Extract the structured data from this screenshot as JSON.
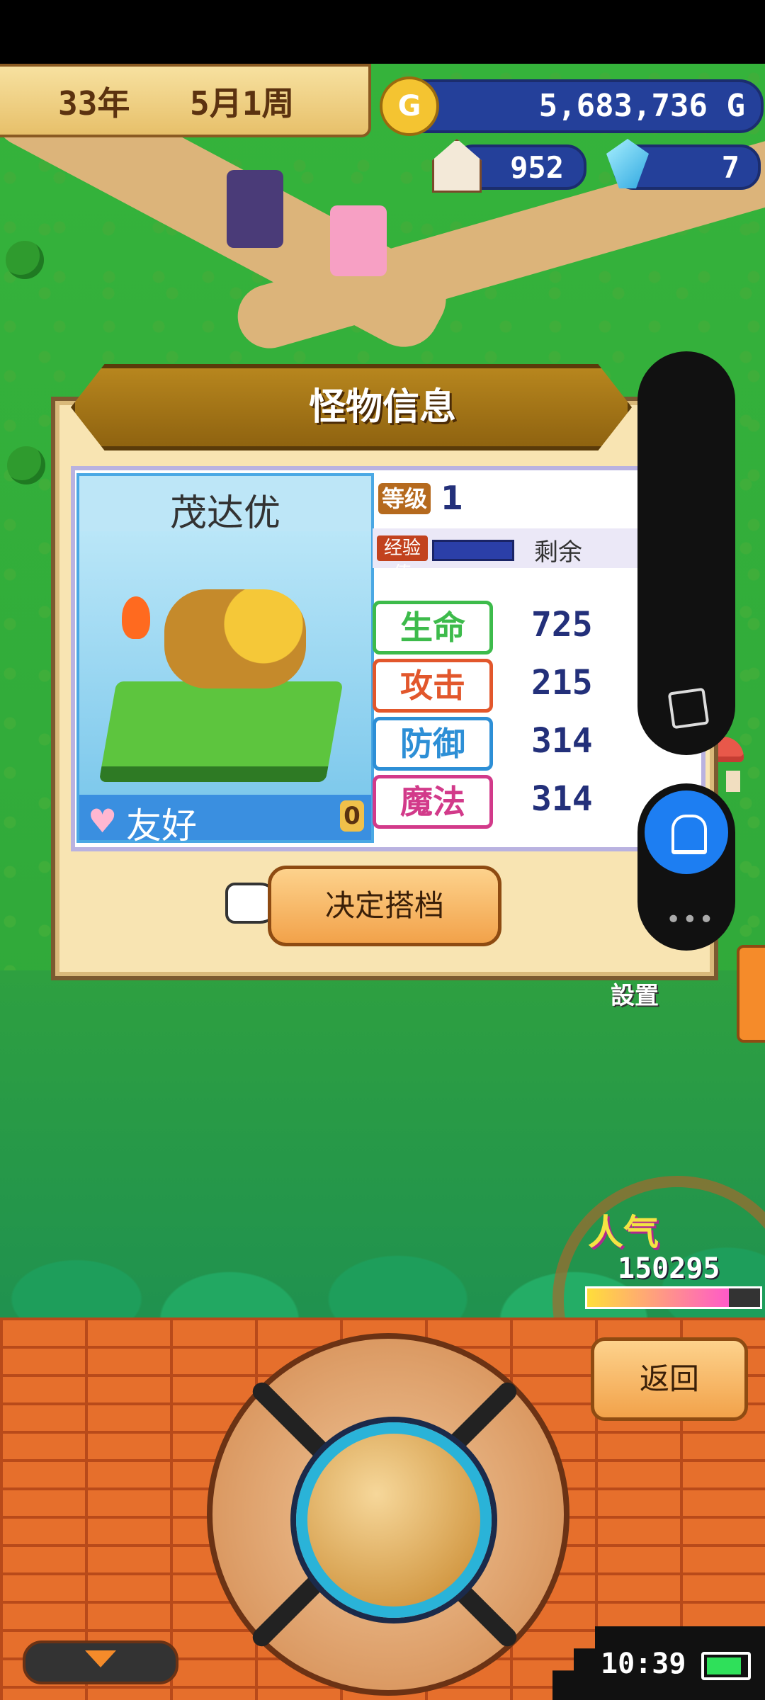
{
  "hud": {
    "year": "33年",
    "week": "5月1周",
    "gold": "5,683,736 G",
    "gold_icon": "G",
    "population": "952",
    "gems": "7"
  },
  "dialog": {
    "title": "怪物信息",
    "monster_name": "茂达优",
    "friendship_label": "友好",
    "friendship_value": "0",
    "level_label": "等级",
    "level_value": "1",
    "exp_label": "经验值",
    "exp_remaining": "剩余",
    "stats": [
      {
        "label": "生命",
        "value": "725",
        "color": "#3dbb4b"
      },
      {
        "label": "攻击",
        "value": "215",
        "color": "#e2572c"
      },
      {
        "label": "防御",
        "value": "314",
        "color": "#2d8fd6"
      },
      {
        "label": "魔法",
        "value": "314",
        "color": "#d23a8a"
      }
    ],
    "confirm_button": "决定搭档"
  },
  "overlay": {
    "settings_label": "設置"
  },
  "popularity": {
    "label": "人气",
    "value": "150295",
    "level": 0.82
  },
  "controls": {
    "back_button": "返回"
  },
  "status": {
    "clock": "10:39"
  }
}
